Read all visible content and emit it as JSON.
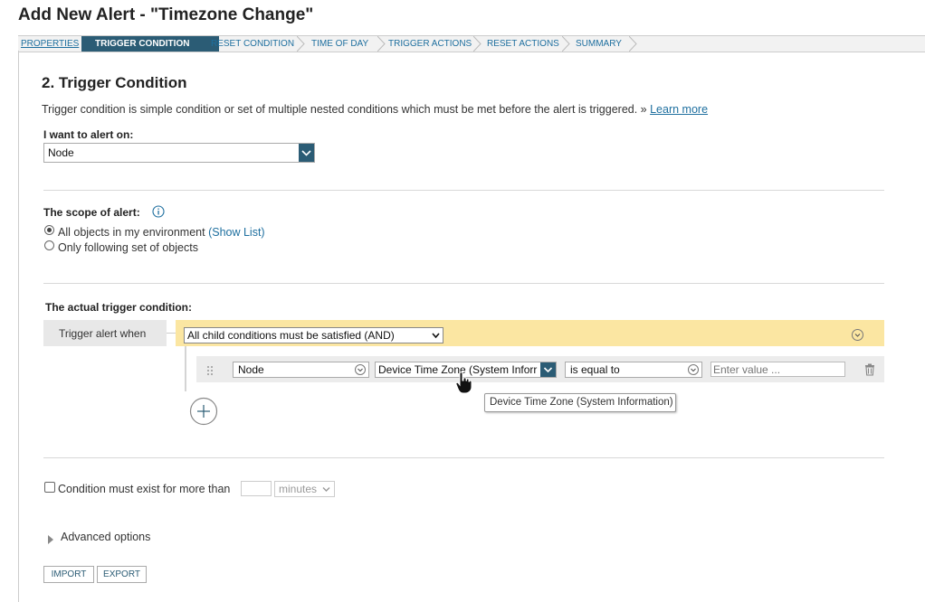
{
  "page": {
    "title": "Add New Alert - \"Timezone Change\""
  },
  "wizard": {
    "steps": [
      {
        "label": "PROPERTIES"
      },
      {
        "label": "TRIGGER CONDITION"
      },
      {
        "label": "RESET CONDITION"
      },
      {
        "label": "TIME OF DAY"
      },
      {
        "label": "TRIGGER ACTIONS"
      },
      {
        "label": "RESET ACTIONS"
      },
      {
        "label": "SUMMARY"
      }
    ]
  },
  "section": {
    "title": "2. Trigger Condition",
    "description": "Trigger condition is simple condition or set of multiple nested conditions which must be met before the alert is triggered. »",
    "learn_more": "Learn more"
  },
  "alert_on": {
    "label": "I want to alert on:",
    "value": "Node"
  },
  "scope": {
    "label": "The scope of alert:",
    "options": [
      {
        "label": "All objects in my environment",
        "link": "(Show List)",
        "selected": true
      },
      {
        "label": "Only following set of objects",
        "selected": false
      }
    ]
  },
  "trigger": {
    "label": "The actual trigger condition:",
    "when_label": "Trigger alert when",
    "group_value": "All child conditions must be satisfied (AND)",
    "condition": {
      "object": "Node",
      "field": "Device Time Zone (System Inforr",
      "operator": "is equal to",
      "value_placeholder": "Enter value ..."
    },
    "tooltip": "Device Time Zone (System Information)"
  },
  "duration": {
    "label": "Condition must exist for more than",
    "unit": "minutes",
    "checked": false
  },
  "advanced": {
    "label": "Advanced options"
  },
  "buttons": {
    "import": "IMPORT",
    "export": "EXPORT"
  },
  "colors": {
    "accent": "#2b5c75",
    "link": "#1e6f9f",
    "trigger_bar": "#fbe6a2"
  }
}
